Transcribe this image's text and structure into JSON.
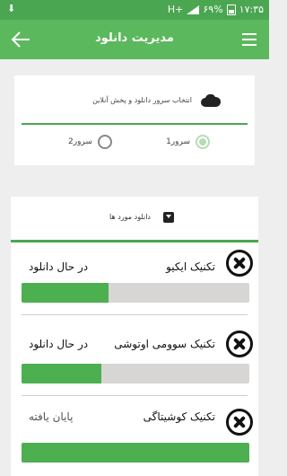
{
  "status_bar": {
    "time": "۱۷:۳۵",
    "battery": "۶۹%",
    "network": "H+"
  },
  "app_bar": {
    "title": "مدیریت دانلود"
  },
  "server_card": {
    "title": "انتخاب سرور دانلود و پخش آنلاین",
    "options": [
      {
        "label": "سرور1",
        "selected": true
      },
      {
        "label": "سرور2",
        "selected": false
      }
    ]
  },
  "downloads_card": {
    "header": "دانلود مورد ها",
    "items": [
      {
        "name": "تکنیک ایکیو",
        "status": "در حال دانلود",
        "progress_percent": 38
      },
      {
        "name": "تکنیک سوومی اوتوشی",
        "status": "در حال دانلود",
        "progress_percent": 35
      },
      {
        "name": "تکنیک کوشیتاگی",
        "status": "پایان یافته",
        "progress_percent": 100
      }
    ]
  },
  "colors": {
    "primary": "#5cb85c",
    "status_bar": "#4aa650",
    "progress": "#4caf50",
    "track": "#d8d5d5"
  }
}
